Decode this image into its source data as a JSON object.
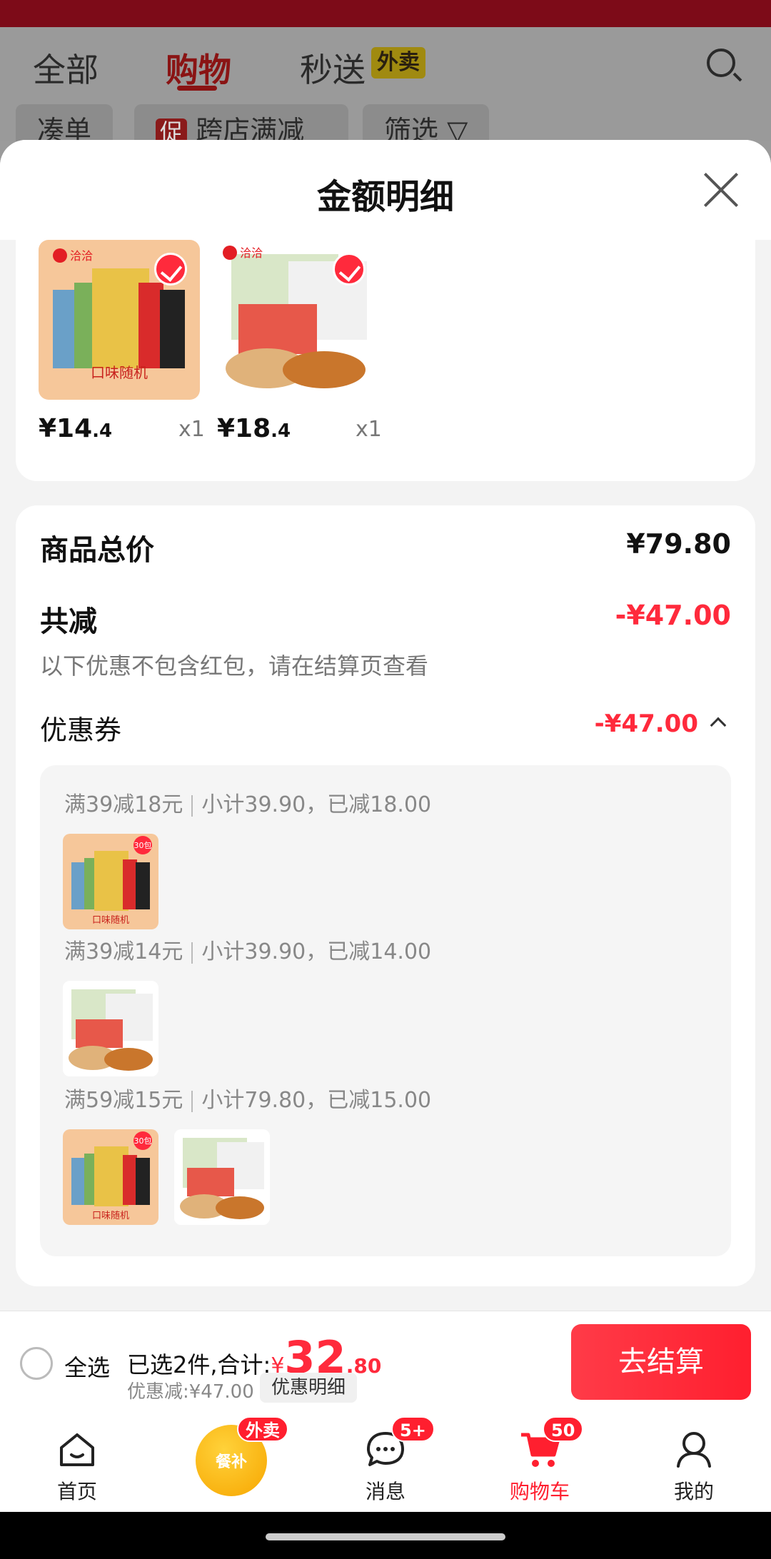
{
  "background": {
    "tabs": [
      "全部",
      "购物",
      "秒送"
    ],
    "active_tab": "购物",
    "badge": "外卖",
    "chips": [
      "凑单",
      "跨店满减",
      "筛选"
    ],
    "chip_badge": "促"
  },
  "sheet": {
    "title": "金额明细",
    "products": [
      {
        "brand": "洽洽",
        "price_int": "¥14",
        "price_dec": ".4",
        "qty": "x1",
        "label": "口味随机",
        "color": "#f5b98a"
      },
      {
        "brand": "洽洽",
        "price_int": "¥18",
        "price_dec": ".4",
        "qty": "x1",
        "color": "#ffffff"
      }
    ],
    "total": {
      "label": "商品总价",
      "value": "¥79.80"
    },
    "reduce": {
      "label": "共减",
      "value": "-¥47.00",
      "note": "以下优惠不包含红包，请在结算页查看"
    },
    "coupon": {
      "label": "优惠券",
      "value": "-¥47.00"
    },
    "rules": [
      {
        "title": "满39减18元",
        "detail": "小计39.90，已减18.00"
      },
      {
        "title": "满39减14元",
        "detail": "小计39.90，已减14.00"
      },
      {
        "title": "满59减15元",
        "detail": "小计79.80，已减15.00"
      }
    ],
    "thumb_tag": "30包",
    "thumb_label": "口味随机"
  },
  "bottom": {
    "select_all": "全选",
    "summary_prefix": "已选2件,合计:",
    "yen": "¥",
    "amount_int": "32",
    "amount_dec": ".80",
    "discount": "优惠减:¥47.00",
    "detail_button": "优惠明细",
    "checkout": "去结算"
  },
  "tabbar": {
    "items": [
      "首页",
      "",
      "消息",
      "购物车",
      "我的"
    ],
    "meal_label": "餐补",
    "meal_badge": "外卖",
    "msg_badge": "5+",
    "cart_badge": "50",
    "active_color": "#ff1f2f"
  }
}
